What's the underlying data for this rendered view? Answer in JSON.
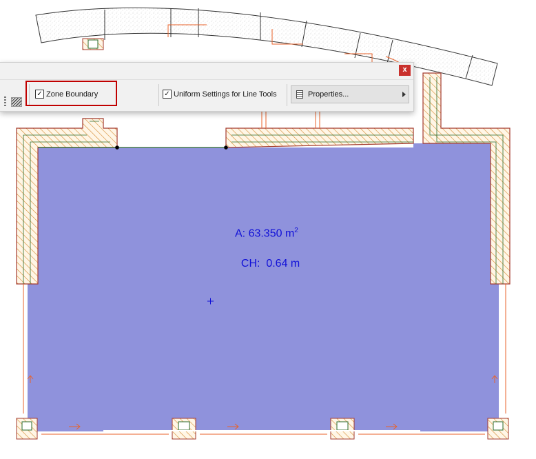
{
  "toolbar": {
    "close_label": "x",
    "zone_boundary": {
      "label": "Zone Boundary",
      "checked": true
    },
    "uniform_settings": {
      "label": "Uniform Settings for Line Tools",
      "checked": true
    },
    "properties_label": "Properties..."
  },
  "zone": {
    "area_label": "A: 63.350 m",
    "area_unit_sup": "2",
    "height_label": "CH:  0.64 m",
    "fill_color": "#8f92dc"
  },
  "colors": {
    "wall_outline": "#a33a2e",
    "wall_hatch": "#d48a30",
    "orange_line": "#e8622a",
    "highlight": "#c00000",
    "label_color": "#1010d8"
  }
}
